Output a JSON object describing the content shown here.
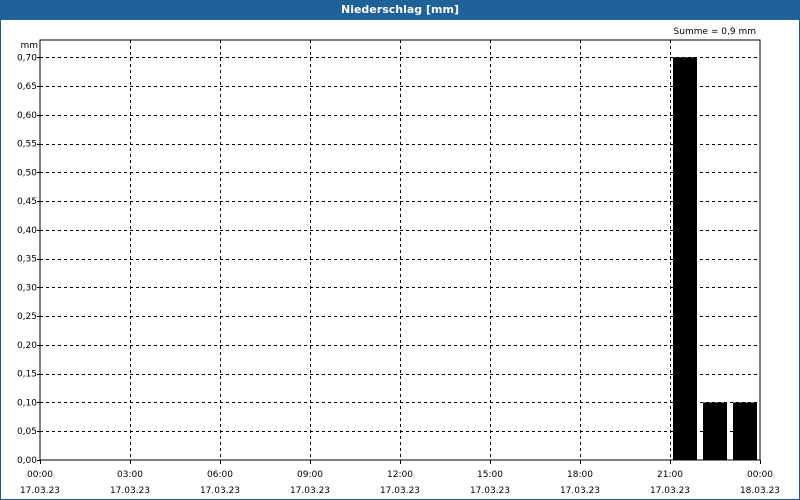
{
  "chart_data": {
    "type": "bar",
    "title": "Niederschlag [mm]",
    "ylabel": "mm",
    "summary": "Summe = 0,9 mm",
    "ylim": [
      0,
      0.73
    ],
    "yticks": [
      "0,00",
      "0,05",
      "0,10",
      "0,15",
      "0,20",
      "0,25",
      "0,30",
      "0,35",
      "0,40",
      "0,45",
      "0,50",
      "0,55",
      "0,60",
      "0,65",
      "0,70"
    ],
    "ytick_values": [
      0,
      0.05,
      0.1,
      0.15,
      0.2,
      0.25,
      0.3,
      0.35,
      0.4,
      0.45,
      0.5,
      0.55,
      0.6,
      0.65,
      0.7
    ],
    "x_range_hours": [
      0,
      24
    ],
    "xticks": [
      {
        "hour": 0,
        "time": "00:00",
        "date": "17.03.23"
      },
      {
        "hour": 3,
        "time": "03:00",
        "date": "17.03.23"
      },
      {
        "hour": 6,
        "time": "06:00",
        "date": "17.03.23"
      },
      {
        "hour": 9,
        "time": "09:00",
        "date": "17.03.23"
      },
      {
        "hour": 12,
        "time": "12:00",
        "date": "17.03.23"
      },
      {
        "hour": 15,
        "time": "15:00",
        "date": "17.03.23"
      },
      {
        "hour": 18,
        "time": "18:00",
        "date": "17.03.23"
      },
      {
        "hour": 21,
        "time": "21:00",
        "date": "17.03.23"
      },
      {
        "hour": 24,
        "time": "00:00",
        "date": "18.03.23"
      }
    ],
    "bars": [
      {
        "hour": 21,
        "value": 0.7
      },
      {
        "hour": 22,
        "value": 0.1
      },
      {
        "hour": 23,
        "value": 0.1
      }
    ],
    "grid": true,
    "bar_color": "#000000",
    "title_bar_color": "#1f6199"
  }
}
